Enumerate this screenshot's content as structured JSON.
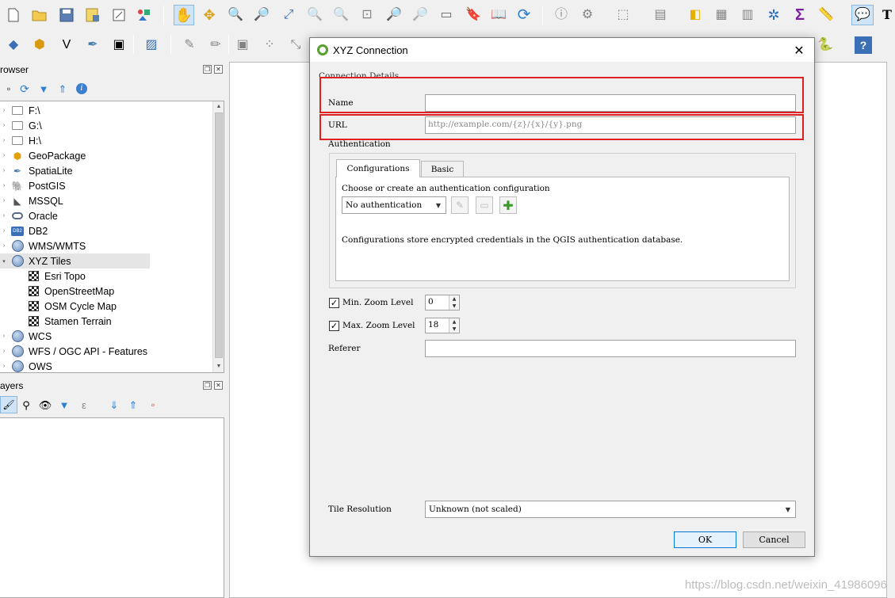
{
  "toolbar": {
    "icons": [
      "new-project-icon",
      "open-project-icon",
      "save-project-icon",
      "save-as-icon",
      "print-layout-icon",
      "style-manager-icon",
      "pan-icon",
      "pan-to-selection-icon",
      "zoom-in-icon",
      "zoom-out-icon",
      "zoom-full-icon",
      "zoom-selection-icon",
      "zoom-layer-icon",
      "zoom-native-icon",
      "zoom-last-icon",
      "zoom-next-icon",
      "new-map-view-icon",
      "new-bookmark-icon",
      "show-bookmarks-icon",
      "refresh-icon",
      "identify-icon",
      "select-icon",
      "deselect-icon",
      "attribute-table-icon",
      "field-calculator-icon",
      "statistics-icon",
      "processing-icon",
      "sum-icon",
      "measure-icon",
      "tips-icon",
      "text-annotation-icon"
    ]
  },
  "browser": {
    "title": "rowser",
    "items": [
      {
        "label": "F:\\",
        "icon": "folder-icon"
      },
      {
        "label": "G:\\",
        "icon": "folder-icon"
      },
      {
        "label": "H:\\",
        "icon": "folder-icon"
      },
      {
        "label": "GeoPackage",
        "icon": "geopackage-icon"
      },
      {
        "label": "SpatiaLite",
        "icon": "spatialite-icon"
      },
      {
        "label": "PostGIS",
        "icon": "postgis-icon"
      },
      {
        "label": "MSSQL",
        "icon": "mssql-icon"
      },
      {
        "label": "Oracle",
        "icon": "oracle-icon"
      },
      {
        "label": "DB2",
        "icon": "db2-icon"
      },
      {
        "label": "WMS/WMTS",
        "icon": "globe-icon"
      },
      {
        "label": "XYZ Tiles",
        "icon": "globe-icon"
      },
      {
        "label": "Esri Topo",
        "icon": "tile-icon"
      },
      {
        "label": "OpenStreetMap",
        "icon": "tile-icon"
      },
      {
        "label": "OSM Cycle Map",
        "icon": "tile-icon"
      },
      {
        "label": "Stamen Terrain",
        "icon": "tile-icon"
      },
      {
        "label": "WCS",
        "icon": "globe-icon"
      },
      {
        "label": "WFS / OGC API - Features",
        "icon": "globe-icon"
      },
      {
        "label": "OWS",
        "icon": "globe-icon"
      }
    ],
    "db2_badge": "DB2"
  },
  "layers": {
    "title": "ayers"
  },
  "dialog": {
    "title": "XYZ Connection",
    "group_connection": "Connection Details",
    "name_label": "Name",
    "name_value": "",
    "url_label": "URL",
    "url_placeholder": "http://example.com/{z}/{x}/{y}.png",
    "auth_label": "Authentication",
    "tab_configurations": "Configurations",
    "tab_basic": "Basic",
    "auth_prompt": "Choose or create an authentication configuration",
    "auth_select": "No authentication",
    "auth_note": "Configurations store encrypted credentials in the QGIS authentication database.",
    "min_zoom_label": "Min. Zoom Level",
    "min_zoom_value": "0",
    "max_zoom_label": "Max. Zoom Level",
    "max_zoom_value": "18",
    "referer_label": "Referer",
    "referer_value": "",
    "tile_resolution_label": "Tile Resolution",
    "tile_resolution_value": "Unknown (not scaled)",
    "ok_label": "OK",
    "cancel_label": "Cancel"
  },
  "watermark": "https://blog.csdn.net/weixin_41986096",
  "colors": {
    "highlight_box": "#e02020",
    "qgis_green": "#5a9e2f"
  }
}
